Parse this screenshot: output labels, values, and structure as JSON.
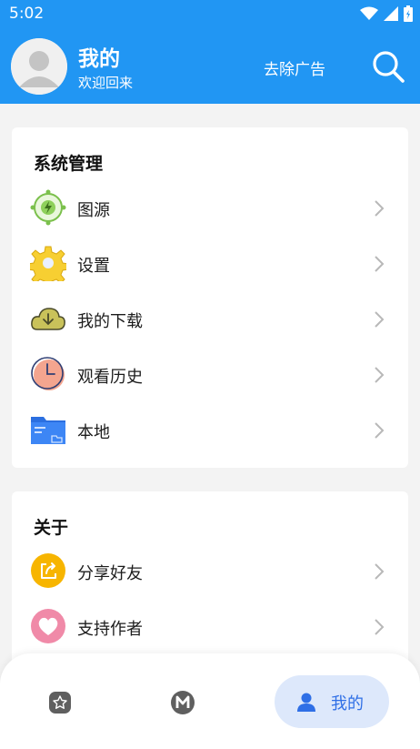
{
  "status_bar": {
    "time": "5:02"
  },
  "header": {
    "title": "我的",
    "subtitle": "欢迎回来",
    "remove_ads_label": "去除广告"
  },
  "system_section": {
    "title": "系统管理",
    "items": [
      {
        "label": "图源",
        "icon": "source-icon"
      },
      {
        "label": "设置",
        "icon": "gear-icon"
      },
      {
        "label": "我的下载",
        "icon": "download-cloud-icon"
      },
      {
        "label": "观看历史",
        "icon": "clock-icon"
      },
      {
        "label": "本地",
        "icon": "folder-icon"
      }
    ]
  },
  "about_section": {
    "title": "关于",
    "items": [
      {
        "label": "分享好友",
        "icon": "share-icon"
      },
      {
        "label": "支持作者",
        "icon": "heart-icon"
      }
    ]
  },
  "bottom_nav": {
    "items": [
      {
        "icon": "star-icon"
      },
      {
        "icon": "m-icon"
      },
      {
        "label": "我的",
        "icon": "person-icon",
        "active": true
      }
    ]
  },
  "colors": {
    "primary": "#2196f3",
    "background": "#f3f3f3",
    "nav_active_bg": "#dde8fb",
    "nav_active_text": "#2f6fe6"
  }
}
